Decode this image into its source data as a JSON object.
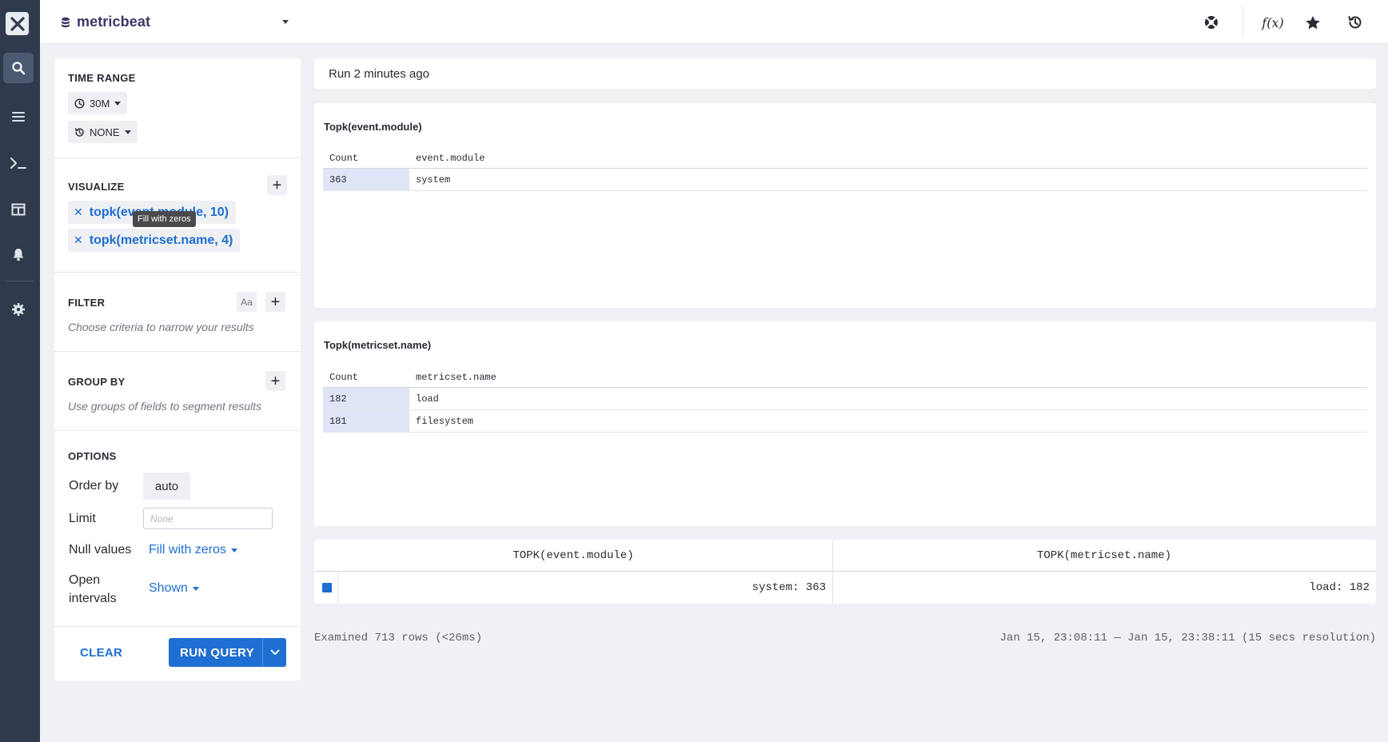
{
  "header": {
    "datasource": "metricbeat",
    "icons": [
      "help-icon",
      "function-icon",
      "star-icon",
      "history-icon"
    ],
    "fx_label": "f(x)"
  },
  "nav": {
    "icons": [
      "logo-icon",
      "search-icon",
      "list-icon",
      "terminal-icon",
      "table-icon",
      "bell-icon",
      "gear-icon"
    ],
    "active": "search-icon"
  },
  "builder": {
    "time_range": {
      "title": "TIME RANGE",
      "range": "30M",
      "compare": "NONE"
    },
    "visualize": {
      "title": "VISUALIZE",
      "items": [
        "topk(event.module, 10)",
        "topk(metricset.name, 4)"
      ],
      "tooltip": "Fill with zeros"
    },
    "filter": {
      "title": "FILTER",
      "case_toggle": "Aa",
      "hint": "Choose criteria to narrow your results"
    },
    "group_by": {
      "title": "GROUP BY",
      "hint": "Use groups of fields to segment results"
    },
    "options": {
      "title": "OPTIONS",
      "order_by_label": "Order by",
      "order_by_value": "auto",
      "limit_label": "Limit",
      "limit_placeholder": "None",
      "null_values_label": "Null values",
      "null_values_value": "Fill with zeros",
      "open_intervals_label_1": "Open",
      "open_intervals_label_2": "intervals",
      "open_intervals_value": "Shown"
    },
    "clear_label": "CLEAR",
    "run_label": "RUN QUERY"
  },
  "main": {
    "status": "Run 2 minutes ago",
    "charts": [
      {
        "title": "Topk(event.module)",
        "col_count": "Count",
        "col_field": "event.module",
        "rows": [
          {
            "count": "363",
            "value": "system"
          }
        ]
      },
      {
        "title": "Topk(metricset.name)",
        "col_count": "Count",
        "col_field": "metricset.name",
        "rows": [
          {
            "count": "182",
            "value": "load"
          },
          {
            "count": "181",
            "value": "filesystem"
          }
        ]
      }
    ],
    "legend": {
      "col1": "TOPK(event.module)",
      "col2": "TOPK(metricset.name)",
      "val1": "system: 363",
      "val2": "load: 182",
      "swatch_color": "#1f6ed1"
    },
    "footer_left": "Examined 713 rows (<26ms)",
    "footer_right": "Jan 15, 23:08:11 — Jan 15, 23:38:11 (15 secs resolution)"
  }
}
